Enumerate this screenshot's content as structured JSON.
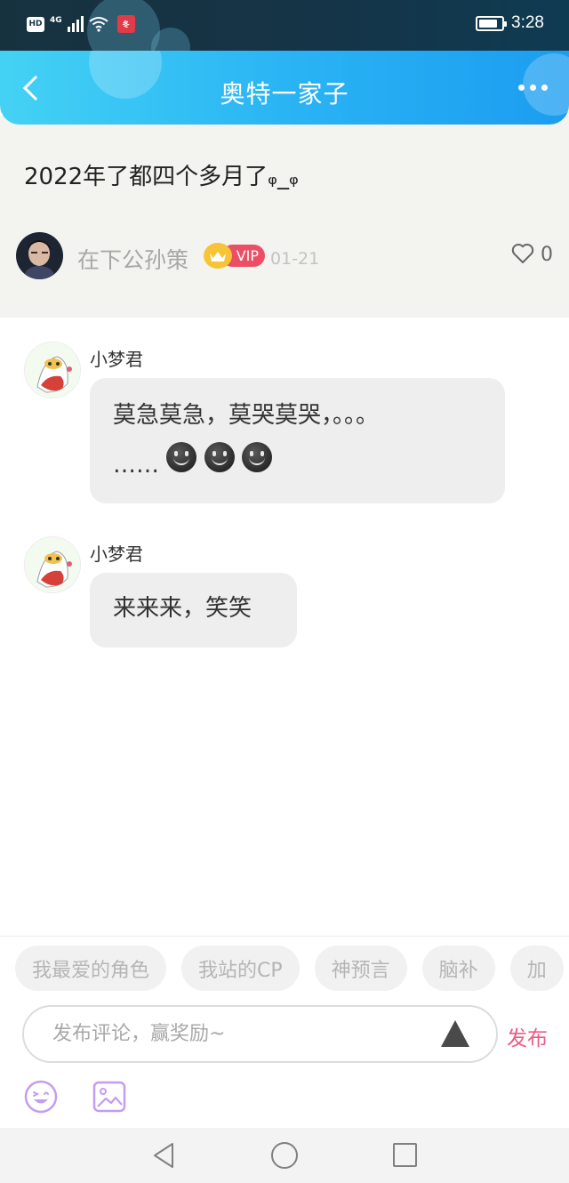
{
  "status_bar": {
    "hd": "HD",
    "network": "4G",
    "app_badge": "冬",
    "time": "3:28",
    "battery_level": 0.85
  },
  "header": {
    "title": "奥特一家子"
  },
  "post": {
    "title": "2022年了都四个多月了ᵩ_ᵩ",
    "author": {
      "name": "在下公孙策",
      "badge": "VIP"
    },
    "date": "01-21",
    "likes": "0"
  },
  "comments": [
    {
      "name": "小梦君",
      "lines": [
        "莫急莫急，莫哭莫哭，。。。",
        "……"
      ],
      "emoji_count": 3
    },
    {
      "name": "小梦君",
      "lines": [
        "来来来，笑笑"
      ]
    }
  ],
  "tags": [
    "我最爱的角色",
    "我站的CP",
    "神预言",
    "脑补",
    "加"
  ],
  "composer": {
    "placeholder": "发布评论，赢奖励~",
    "publish_label": "发布"
  },
  "colors": {
    "accent": "#2ab4f4",
    "publish": "#ee5a84",
    "vip": "#ea4f66"
  }
}
